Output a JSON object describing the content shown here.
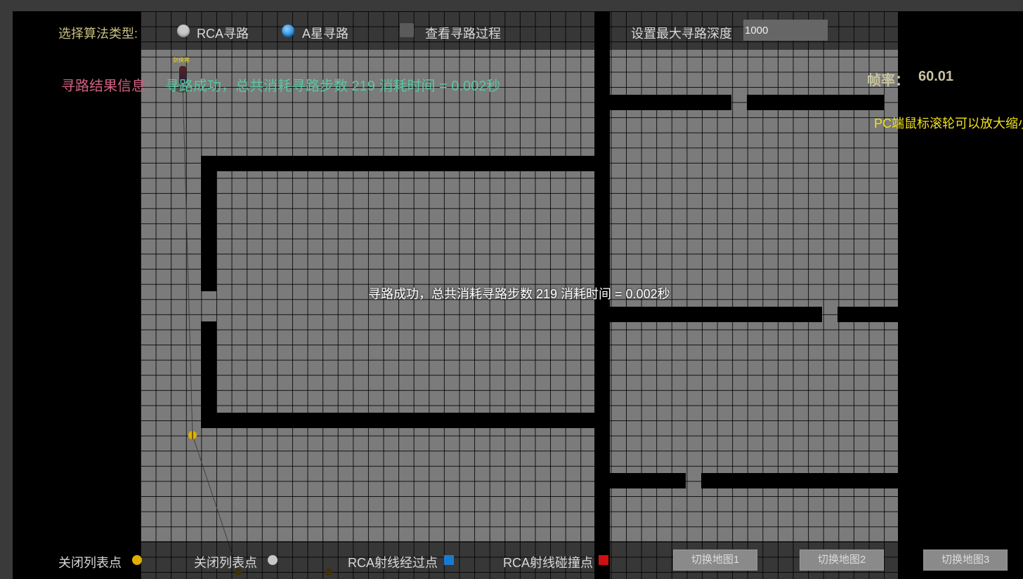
{
  "toolbar": {
    "algo_label": "选择算法类型:",
    "rca_label": "RCA寻路",
    "astar_label": "A星寻路",
    "selected_algo": "A星寻路",
    "view_process_label": "查看寻路过程",
    "view_process_checked": false,
    "max_depth_label": "设置最大寻路深度",
    "max_depth_value": "1000"
  },
  "result": {
    "label": "寻路结果信息:",
    "text": "寻路成功，总共消耗寻路步数 219 消耗时间 = 0.002秒"
  },
  "fps": {
    "label": "帧率：",
    "value": "60.01"
  },
  "tip": "PC端鼠标滚轮可以放大缩小",
  "toast": "寻路成功，总共消耗寻路步数 219 消耗时间 = 0.002秒",
  "character": {
    "name": "剑侠客"
  },
  "legend": {
    "closed_list_1": "关闭列表点",
    "closed_list_2": "关闭列表点",
    "ray_pass": "RCA射线经过点",
    "ray_hit": "RCA射线碰撞点"
  },
  "buttons": {
    "map1": "切换地图1",
    "map2": "切换地图2",
    "map3": "切换地图3"
  },
  "colors": {
    "algo_label": "#c9c080",
    "result_label": "#d06080",
    "result_text": "#58c8a0",
    "ui_text": "#d8d8d8",
    "closed_point_yellow": "#e0b000",
    "closed_point_gray": "#c8c8c8",
    "ray_pass_blue": "#1a7ad0",
    "ray_hit_red": "#d01010",
    "tip_yellow": "#f2e21a"
  }
}
